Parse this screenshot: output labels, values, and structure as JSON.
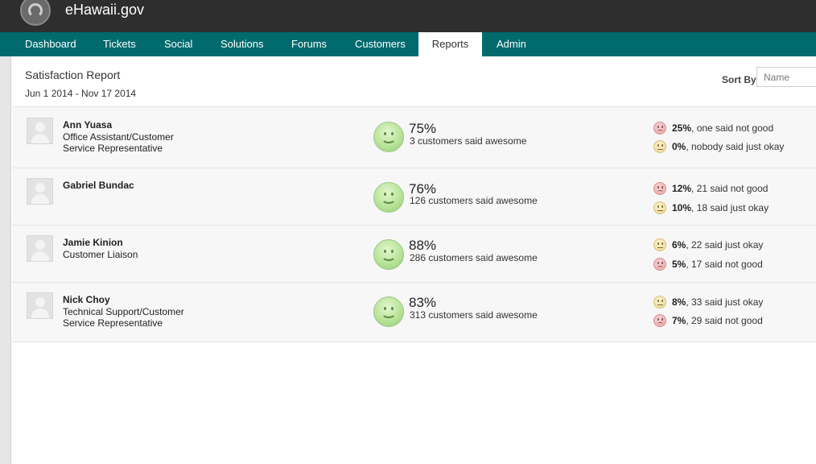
{
  "header": {
    "brand": "eHawaii.gov"
  },
  "nav": {
    "items": [
      {
        "label": "Dashboard"
      },
      {
        "label": "Tickets"
      },
      {
        "label": "Social"
      },
      {
        "label": "Solutions"
      },
      {
        "label": "Forums"
      },
      {
        "label": "Customers"
      },
      {
        "label": "Reports"
      },
      {
        "label": "Admin"
      }
    ],
    "active": "Reports"
  },
  "report": {
    "title": "Satisfaction Report",
    "date_range": "Jun 1 2014 - Nov 17 2014",
    "sort_label": "Sort By",
    "sort_placeholder": "Name"
  },
  "rows": [
    {
      "name": "Ann Yuasa",
      "role_line1": "Office Assistant/Customer",
      "role_line2": "Service Representative",
      "awesome_pct": "75%",
      "awesome_text": "3 customers said awesome",
      "stats": [
        {
          "mood": "sad",
          "pct": "25%",
          "text": ", one said not good"
        },
        {
          "mood": "okay",
          "pct": "0%",
          "text": ", nobody said just okay"
        }
      ]
    },
    {
      "name": "Gabriel Bundac",
      "role_line1": "",
      "role_line2": "",
      "awesome_pct": "76%",
      "awesome_text": "126 customers said awesome",
      "stats": [
        {
          "mood": "sad",
          "pct": "12%",
          "text": ", 21 said not good"
        },
        {
          "mood": "okay",
          "pct": "10%",
          "text": ", 18 said just okay"
        }
      ]
    },
    {
      "name": "Jamie Kinion",
      "role_line1": "Customer Liaison",
      "role_line2": "",
      "awesome_pct": "88%",
      "awesome_text": "286 customers said awesome",
      "stats": [
        {
          "mood": "okay",
          "pct": "6%",
          "text": ", 22 said just okay"
        },
        {
          "mood": "sad",
          "pct": "5%",
          "text": ", 17 said not good"
        }
      ]
    },
    {
      "name": "Nick Choy",
      "role_line1": "Technical Support/Customer",
      "role_line2": "Service Representative",
      "awesome_pct": "83%",
      "awesome_text": "313 customers said awesome",
      "stats": [
        {
          "mood": "okay",
          "pct": "8%",
          "text": ", 33 said just okay"
        },
        {
          "mood": "sad",
          "pct": "7%",
          "text": ", 29 said not good"
        }
      ]
    }
  ],
  "icons": {
    "logo": "ehawaii-logo-icon",
    "avatar": "user-avatar-icon",
    "awesome": "smiley-face-icon",
    "sad": "sad-face-icon",
    "okay": "neutral-face-icon"
  },
  "colors": {
    "topbar": "#2e2e2e",
    "nav": "#006a6d",
    "row_bg": "#f7f7f7",
    "awesome_green": "#b8e398",
    "sad_red": "#eca4a4",
    "okay_yellow": "#eed98f"
  }
}
